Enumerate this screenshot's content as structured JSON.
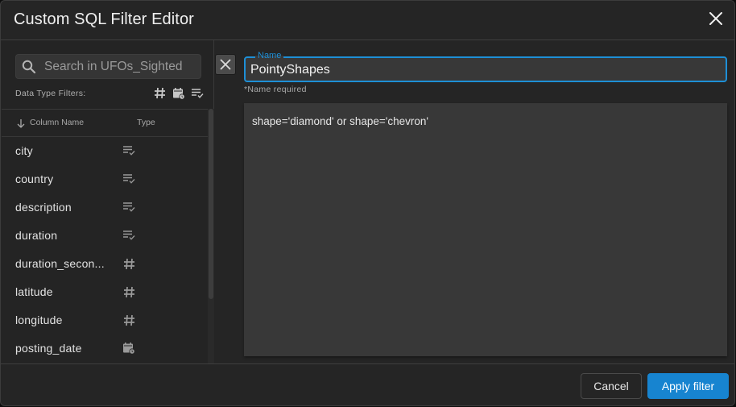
{
  "dialog": {
    "title": "Custom SQL Filter Editor",
    "close_icon": "close-icon"
  },
  "sidebar": {
    "search": {
      "placeholder": "Search in UFOs_Sighted",
      "icon": "search-icon"
    },
    "data_type_filters_label": "Data Type Filters:",
    "data_type_filters": [
      {
        "name": "numeric",
        "icon": "hash-icon"
      },
      {
        "name": "date",
        "icon": "calendar-clock-icon"
      },
      {
        "name": "text",
        "icon": "text-check-icon"
      }
    ],
    "headers": {
      "column_name": "Column Name",
      "type": "Type",
      "sort_icon": "arrow-down-icon"
    },
    "columns": [
      {
        "name": "city",
        "type": "text"
      },
      {
        "name": "country",
        "type": "text"
      },
      {
        "name": "description",
        "type": "text"
      },
      {
        "name": "duration",
        "type": "text"
      },
      {
        "name": "duration_secon...",
        "type": "numeric"
      },
      {
        "name": "latitude",
        "type": "numeric"
      },
      {
        "name": "longitude",
        "type": "numeric"
      },
      {
        "name": "posting_date",
        "type": "date"
      }
    ]
  },
  "editor": {
    "clear_icon": "close-icon",
    "name_label": "Name",
    "name_value": "PointyShapes",
    "name_hint": "*Name required",
    "sql_value": "shape='diamond' or shape='chevron'"
  },
  "footer": {
    "cancel_label": "Cancel",
    "apply_label": "Apply filter"
  },
  "colors": {
    "accent": "#1e8fd6",
    "apply_button": "#1784d0",
    "background": "#252525",
    "input_background": "#383838"
  }
}
